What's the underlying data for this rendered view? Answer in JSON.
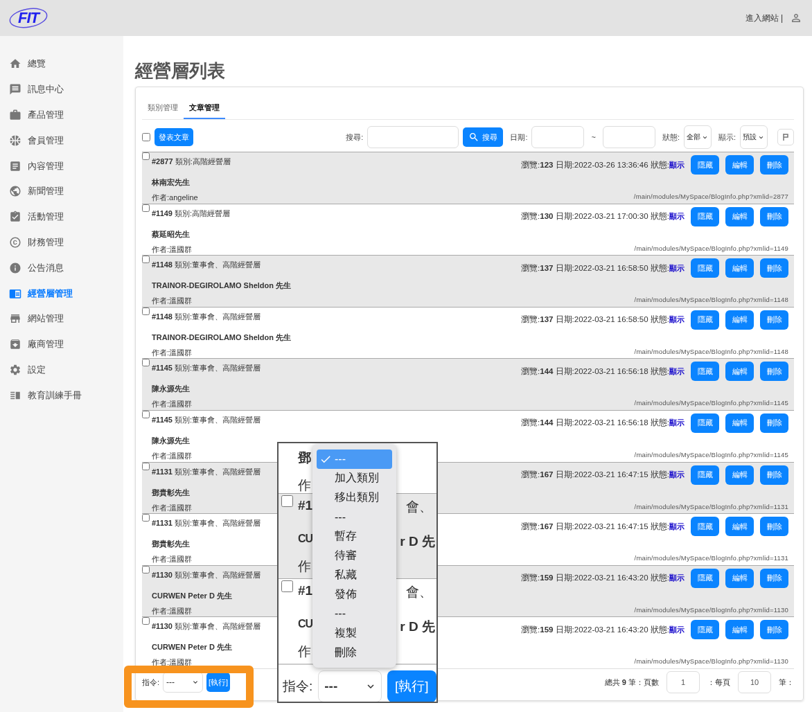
{
  "header": {
    "logo": "FIT",
    "site_link": "進入網站 |"
  },
  "sidebar": {
    "items": [
      {
        "label": "總覽",
        "selected": false
      },
      {
        "label": "訊息中心",
        "selected": false
      },
      {
        "label": "產品管理",
        "selected": false
      },
      {
        "label": "會員管理",
        "selected": false
      },
      {
        "label": "內容管理",
        "selected": false
      },
      {
        "label": "新聞管理",
        "selected": false
      },
      {
        "label": "活動管理",
        "selected": false
      },
      {
        "label": "財務管理",
        "selected": false
      },
      {
        "label": "公告消息",
        "selected": false
      },
      {
        "label": "經營層管理",
        "selected": true
      },
      {
        "label": "網站管理",
        "selected": false
      },
      {
        "label": "廠商管理",
        "selected": false
      },
      {
        "label": "設定",
        "selected": false
      },
      {
        "label": "教育訓練手冊",
        "selected": false
      }
    ]
  },
  "page_title": "經營層列表",
  "tabs": [
    {
      "label": "類別管理",
      "selected": false
    },
    {
      "label": "文章管理",
      "selected": true
    }
  ],
  "toolbar": {
    "select_all": {
      "checked": false
    },
    "publish_button": "發表文章",
    "search_label": "搜尋:",
    "search_button": "搜尋",
    "date_label": "日期:",
    "date_separator": "~",
    "status_label": "狀態:",
    "status_value": "全部",
    "display_label": "顯示:",
    "display_value": "預設"
  },
  "rows": [
    {
      "title": "**#2877** 類別:高階經營層",
      "stats": "瀏覽:**123** 日期:2022-03-26 13:36:46 狀態:",
      "status": "顯示",
      "buttons": [
        "隱藏",
        "編輯",
        "刪除"
      ],
      "name": "林南宏先生",
      "author": "作者:angeline",
      "url": "/main/modules/MySpace/BlogInfo.php?xmlid=2877",
      "shaded": true,
      "checked": false
    },
    {
      "title": "**#1149** 類別:高階經營層",
      "stats": "瀏覽:**130** 日期:2022-03-21 17:00:30 狀態:",
      "status": "顯示",
      "buttons": [
        "隱藏",
        "編輯",
        "刪除"
      ],
      "name": "蔡延昭先生",
      "author": "作者:溫國群",
      "url": "/main/modules/MySpace/BlogInfo.php?xmlid=1149",
      "shaded": false,
      "checked": false
    },
    {
      "title": "**#1148** 類別:董事會、高階經營層",
      "stats": "瀏覽:**137** 日期:2022-03-21 16:58:50 狀態:",
      "status": "顯示",
      "buttons": [
        "隱藏",
        "編輯",
        "刪除"
      ],
      "name": "TRAINOR-DEGIROLAMO Sheldon 先生",
      "author": "作者:溫國群",
      "url": "/main/modules/MySpace/BlogInfo.php?xmlid=1148",
      "shaded": true,
      "checked": false
    },
    {
      "title": "**#1148** 類別:董事會、高階經營層",
      "stats": "瀏覽:**137** 日期:2022-03-21 16:58:50 狀態:",
      "status": "顯示",
      "buttons": [
        "隱藏",
        "編輯",
        "刪除"
      ],
      "name": "TRAINOR-DEGIROLAMO Sheldon 先生",
      "author": "作者:溫國群",
      "url": "/main/modules/MySpace/BlogInfo.php?xmlid=1148",
      "shaded": false,
      "checked": false
    },
    {
      "title": "**#1145** 類別:董事會、高階經營層",
      "stats": "瀏覽:**144** 日期:2022-03-21 16:56:18 狀態:",
      "status": "顯示",
      "buttons": [
        "隱藏",
        "編輯",
        "刪除"
      ],
      "name": "陳永源先生",
      "author": "作者:溫國群",
      "url": "/main/modules/MySpace/BlogInfo.php?xmlid=1145",
      "shaded": true,
      "checked": false
    },
    {
      "title": "**#1145** 類別:董事會、高階經營層",
      "stats": "瀏覽:**144** 日期:2022-03-21 16:56:18 狀態:",
      "status": "顯示",
      "buttons": [
        "隱藏",
        "編輯",
        "刪除"
      ],
      "name": "陳永源先生",
      "author": "作者:溫國群",
      "url": "/main/modules/MySpace/BlogInfo.php?xmlid=1145",
      "shaded": false,
      "checked": false
    },
    {
      "title": "**#1131** 類別:董事會、高階經營層",
      "stats": "瀏覽:**167** 日期:2022-03-21 16:47:15 狀態:",
      "status": "顯示",
      "buttons": [
        "隱藏",
        "編輯",
        "刪除"
      ],
      "name": "鄧貴彰先生",
      "author": "作者:溫國群",
      "url": "/main/modules/MySpace/BlogInfo.php?xmlid=1131",
      "shaded": true,
      "checked": false
    },
    {
      "title": "**#1131** 類別:董事會、高階經營層",
      "stats": "瀏覽:**167** 日期:2022-03-21 16:47:15 狀態:",
      "status": "顯示",
      "buttons": [
        "隱藏",
        "編輯",
        "刪除"
      ],
      "name": "鄧貴彰先生",
      "author": "作者:溫國群",
      "url": "/main/modules/MySpace/BlogInfo.php?xmlid=1131",
      "shaded": false,
      "checked": false
    },
    {
      "title": "**#1130** 類別:董事會、高階經營層",
      "stats": "瀏覽:**159** 日期:2022-03-21 16:43:20 狀態:",
      "status": "顯示",
      "buttons": [
        "隱藏",
        "編輯",
        "刪除"
      ],
      "name": "CURWEN Peter D 先生",
      "author": "作者:溫國群",
      "url": "/main/modules/MySpace/BlogInfo.php?xmlid=1130",
      "shaded": true,
      "checked": false
    },
    {
      "title": "**#1130** 類別:董事會、高階經營層",
      "stats": "瀏覽:**159** 日期:2022-03-21 16:43:20 狀態:",
      "status": "顯示",
      "buttons": [
        "隱藏",
        "編輯",
        "刪除"
      ],
      "name": "CURWEN Peter D 先生",
      "author": "作者:溫國群",
      "url": "/main/modules/MySpace/BlogInfo.php?xmlid=1130",
      "shaded": false,
      "checked": false
    }
  ],
  "footer": {
    "command_label": "指令:",
    "command_value": "---",
    "run_button": "[執行]",
    "total": "總共 **9** 筆：頁數",
    "page": "1",
    "per_page_label": "：每頁",
    "per_page": "10",
    "unit": "筆："
  },
  "zoom_inset": {
    "top_row": {
      "name": "鄧",
      "author": "作"
    },
    "rows": [
      {
        "title_left": "#1",
        "title_right": "會、",
        "name_left": "CU",
        "name_right": "r D 先",
        "author": "作",
        "shaded": true,
        "checked": false
      },
      {
        "title_left": "#1",
        "title_right": "會、",
        "name_left": "CU",
        "name_right": "r D 先",
        "author": "作",
        "shaded": false,
        "checked": false
      }
    ],
    "command_label": "指令:",
    "command_value": "---",
    "run_button": "[執行]",
    "menu": [
      {
        "label": "---",
        "selected": true
      },
      {
        "label": "加入類別",
        "selected": false
      },
      {
        "label": "移出類別",
        "selected": false
      },
      {
        "label": "---",
        "selected": false
      },
      {
        "label": "暫存",
        "selected": false
      },
      {
        "label": "待審",
        "selected": false
      },
      {
        "label": "私藏",
        "selected": false
      },
      {
        "label": "發佈",
        "selected": false
      },
      {
        "label": "---",
        "selected": false
      },
      {
        "label": "複製",
        "selected": false
      },
      {
        "label": "刪除",
        "selected": false
      }
    ]
  }
}
